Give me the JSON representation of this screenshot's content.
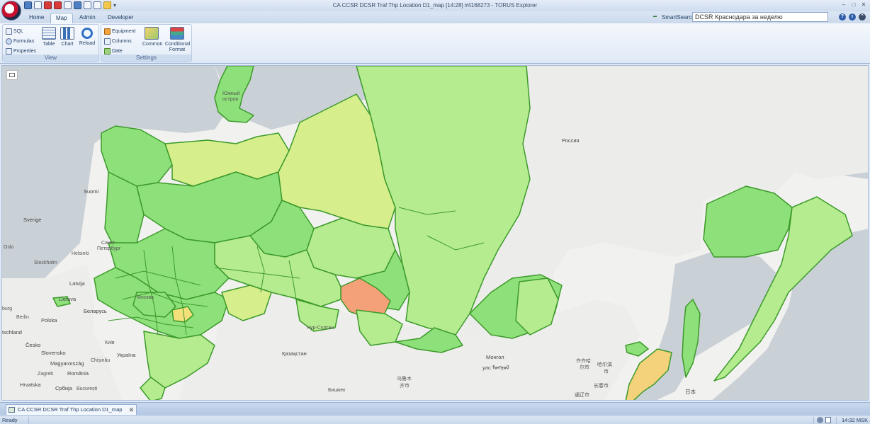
{
  "window": {
    "title": "CA CCSR DCSR Traf Thp Location D1_map [14:28] #4168273 - TORUS Explorer",
    "controls": {
      "minimize": "‒",
      "maximize": "□",
      "close": "✕"
    },
    "qat_more": "▾"
  },
  "ribbon": {
    "tabs": [
      {
        "label": "Home",
        "active": false
      },
      {
        "label": "Map",
        "active": true
      },
      {
        "label": "Admin",
        "active": false
      },
      {
        "label": "Developer",
        "active": false
      }
    ],
    "smartsearch": {
      "label": "SmartSearch:",
      "value": "DCSR Краснодара за неделю"
    },
    "groups": {
      "view": {
        "caption": "View",
        "small": [
          "SQL",
          "Formulas",
          "Properties"
        ],
        "large": [
          "Table",
          "Chart",
          "Reload"
        ]
      },
      "settings": {
        "caption": "Settings",
        "small": [
          "Equipment",
          "Columns",
          "Date"
        ],
        "large": [
          "Common",
          "Conditional Format"
        ]
      }
    }
  },
  "map": {
    "labels": {
      "russia": "Россия",
      "yuzhny": "Южный",
      "ostrov": "остров",
      "suomi": "Suomi",
      "sverige": "Sverige",
      "oslo": "Oslo",
      "stockholm": "Stockholm",
      "helsinki": "Helsinki",
      "sankt1": "Санкт-",
      "sankt2": "Петербург",
      "latvija": "Latvija",
      "lietuva": "Lietuva",
      "burg": "burg",
      "berlin": "Berlin",
      "belarus": "Беларусь",
      "polska": "Polska",
      "deutschland": "tschland",
      "cesko": "Česko",
      "kiev": "Київ",
      "ukraina": "Україна",
      "slovensko": "Slovensko",
      "magyar": "Magyarország",
      "chisinau": "Chișinău",
      "romania": "România",
      "zagreb": "Zagreb",
      "hrvatska": "Hrvatska",
      "srbija": "Србија",
      "bucuresti": "București",
      "moskva": "Москва",
      "nursultan": "Нур-Султан",
      "kazakhstan": "Қазақстан",
      "mongol": "Монгол",
      "mongol_script": "улс ᠮᠣᠩᠭᠣᠯ",
      "urumqi1": "乌鲁木",
      "urumqi2": "齐市",
      "bishkek": "Бишкек",
      "qiqihar1": "齐齐哈",
      "qiqihar2": "尔市",
      "harbin1": "哈尔滨",
      "harbin2": "市",
      "changchun": "长春市",
      "tonghua": "通辽市",
      "nihon": "日本"
    }
  },
  "document_tab": {
    "label": "CA CCSR DCSR Traf Thp Location D1_map",
    "close": "⊠"
  },
  "status": {
    "text": "Ready",
    "time": "14:32 MSK"
  },
  "colors": {
    "green": "#8ee07a",
    "light_green": "#b5ec8f",
    "yellow_green": "#d6ef8c",
    "orange": "#f4a079",
    "yellow": "#f3d27b",
    "border_green": "#3c9a2a",
    "background_land": "#f1f1ef",
    "water": "#c9d0d6"
  }
}
